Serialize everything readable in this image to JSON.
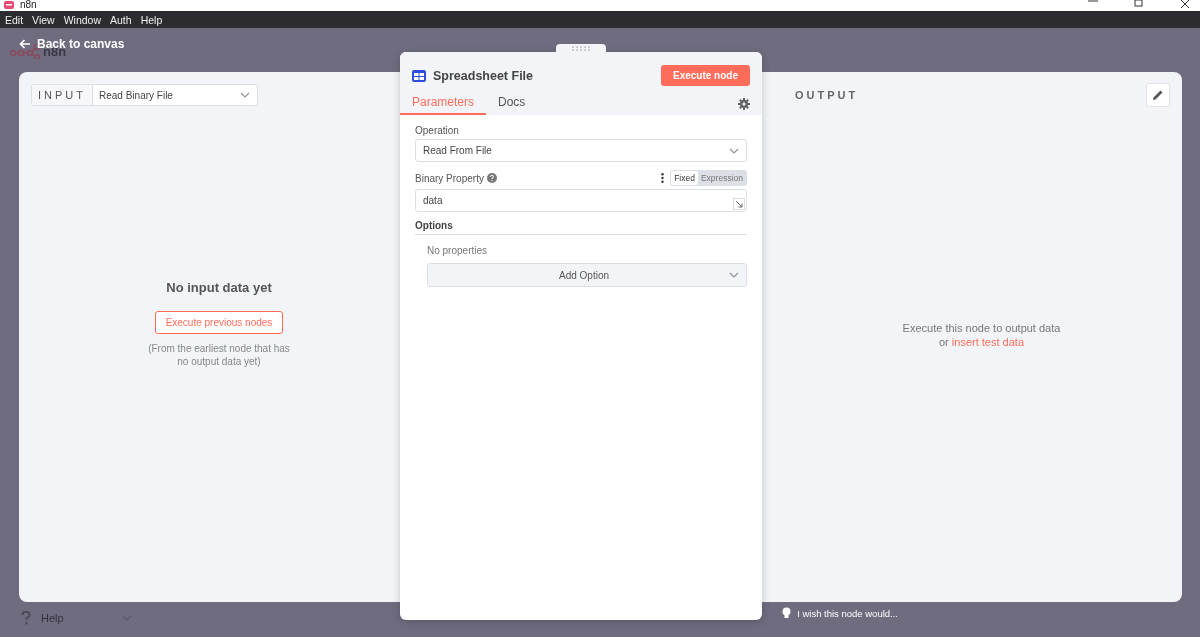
{
  "window": {
    "title": "n8n"
  },
  "menu": [
    {
      "label": "Edit"
    },
    {
      "label": "View"
    },
    {
      "label": "Window"
    },
    {
      "label": "Auth"
    },
    {
      "label": "Help"
    }
  ],
  "back_link": "Back to canvas",
  "canvas_logo": "n8n",
  "input": {
    "label": "INPUT",
    "node_select": "Read Binary File",
    "empty_title": "No input data yet",
    "execute_button": "Execute previous nodes",
    "hint": "(From the earliest node that has no output data yet)"
  },
  "node": {
    "title": "Spreadsheet File",
    "execute_button": "Execute node",
    "tabs": [
      {
        "label": "Parameters",
        "selected": true
      },
      {
        "label": "Docs",
        "selected": false
      }
    ],
    "parameters": [
      {
        "kind": "select",
        "label": "Operation",
        "value": "Read From File"
      },
      {
        "kind": "text",
        "label": "Binary Property",
        "value": "data",
        "mode_toggle": [
          {
            "label": "Fixed",
            "selected": true
          },
          {
            "label": "Expression",
            "selected": false
          }
        ]
      }
    ],
    "options": {
      "title": "Options",
      "empty": "No properties",
      "add_button": "Add Option"
    }
  },
  "output": {
    "label": "OUTPUT",
    "message": "Execute this node to output data",
    "message_prefix": "or",
    "link": "insert test data"
  },
  "help": "Help",
  "feedback": "I wish this node would..."
}
